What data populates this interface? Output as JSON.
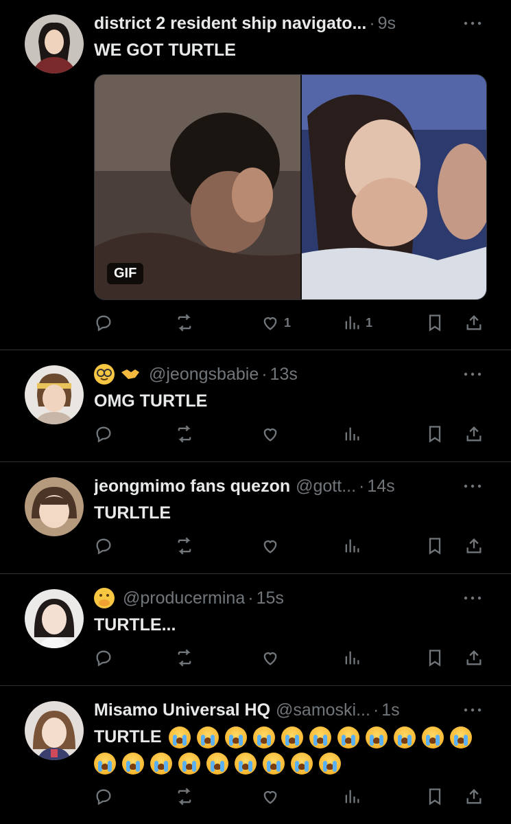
{
  "tweets": [
    {
      "name": "district 2 resident ship navigato...",
      "handle": "",
      "time": "9s",
      "text": "WE GOT TURTLE",
      "media": {
        "type": "gif",
        "badge": "GIF"
      },
      "likes": "1",
      "views": "1"
    },
    {
      "name": "",
      "name_emojis": [
        "nerd-face-emoji",
        "handshake-emoji"
      ],
      "handle": "@jeongsbabie",
      "time": "13s",
      "text": "OMG TURTLE"
    },
    {
      "name": "jeongmimo fans quezon",
      "handle": "@gott...",
      "time": "14s",
      "text": "TURLTLE"
    },
    {
      "name": "",
      "name_emojis": [
        "hand-over-mouth-emoji"
      ],
      "handle": "@producermina",
      "time": "15s",
      "text": "TURTLE..."
    },
    {
      "name": "Misamo Universal HQ",
      "handle": "@samoski...",
      "time": "1s",
      "text": "TURTLE",
      "crying_emoji_count": 20
    }
  ],
  "icons": {
    "reply": "reply-icon",
    "retweet": "retweet-icon",
    "like": "like-icon",
    "views": "views-icon",
    "bookmark": "bookmark-icon",
    "share": "share-icon",
    "more": "more-icon"
  },
  "colors": {
    "background": "#000000",
    "text": "#e7e9ea",
    "muted": "#71767b",
    "divider": "#2f3336"
  }
}
